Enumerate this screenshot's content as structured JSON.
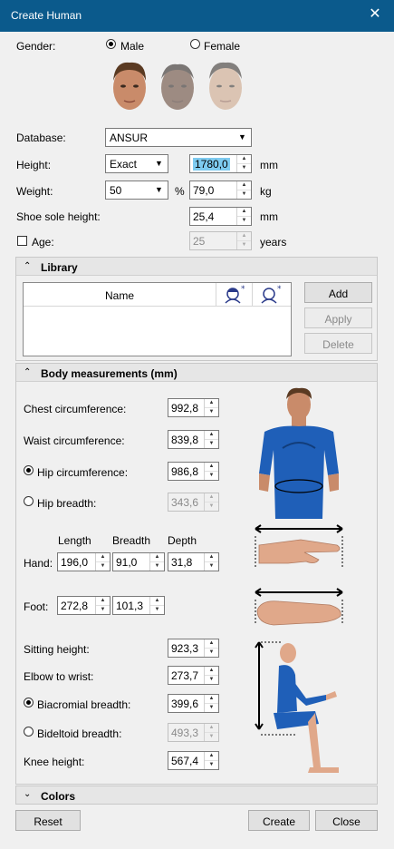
{
  "window": {
    "title": "Create Human",
    "close_icon": "close-icon"
  },
  "gender": {
    "label": "Gender:",
    "options": [
      {
        "label": "Male",
        "selected": true
      },
      {
        "label": "Female",
        "selected": false
      }
    ],
    "faces": [
      "male-face-1",
      "male-face-2",
      "male-face-3"
    ]
  },
  "database": {
    "label": "Database:",
    "value": "ANSUR"
  },
  "height": {
    "label": "Height:",
    "mode": "Exact",
    "value": "1780,0",
    "unit": "mm"
  },
  "weight": {
    "label": "Weight:",
    "percentile": "50",
    "percent_sign": "%",
    "value": "79,0",
    "unit": "kg"
  },
  "shoe": {
    "label": "Shoe sole height:",
    "value": "25,4",
    "unit": "mm"
  },
  "age": {
    "label": "Age:",
    "checked": false,
    "value": "25",
    "unit": "years"
  },
  "library": {
    "title": "Library",
    "column_name": "Name",
    "buttons": {
      "add": "Add",
      "apply": "Apply",
      "delete": "Delete"
    }
  },
  "body": {
    "title": "Body measurements (mm)",
    "chest": {
      "label": "Chest circumference:",
      "value": "992,8"
    },
    "waist": {
      "label": "Waist circumference:",
      "value": "839,8"
    },
    "hip_circ": {
      "label": "Hip circumference:",
      "value": "986,8",
      "selected": true
    },
    "hip_breadth": {
      "label": "Hip breadth:",
      "value": "343,6",
      "selected": false
    },
    "hand": {
      "label": "Hand:",
      "length_label": "Length",
      "breadth_label": "Breadth",
      "depth_label": "Depth",
      "length": "196,0",
      "breadth": "91,0",
      "depth": "31,8"
    },
    "foot": {
      "label": "Foot:",
      "length": "272,8",
      "breadth": "101,3"
    },
    "sitting": {
      "label": "Sitting height:",
      "value": "923,3"
    },
    "elbow": {
      "label": "Elbow to wrist:",
      "value": "273,7"
    },
    "biacromial": {
      "label": "Biacromial breadth:",
      "value": "399,6",
      "selected": true
    },
    "bideltoid": {
      "label": "Bideltoid breadth:",
      "value": "493,3",
      "selected": false
    },
    "knee": {
      "label": "Knee height:",
      "value": "567,4"
    }
  },
  "colors": {
    "title": "Colors"
  },
  "footer": {
    "reset": "Reset",
    "create": "Create",
    "close": "Close"
  }
}
